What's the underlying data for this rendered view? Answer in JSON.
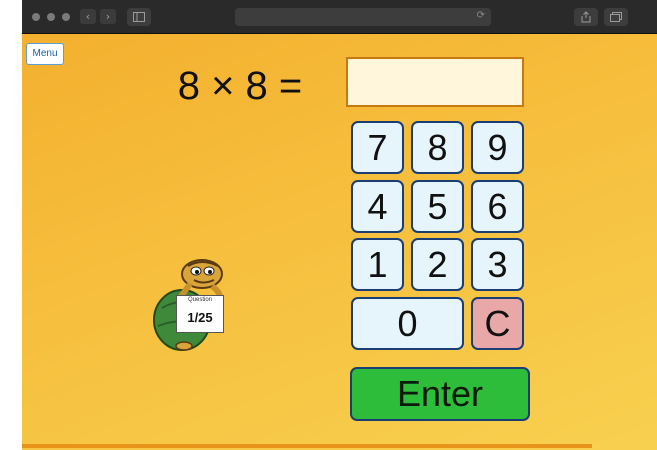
{
  "browser": {
    "nav_back": "‹",
    "nav_forward": "›",
    "sidebar_icon": "sidebar-icon",
    "reload_icon": "⟳",
    "share_icon": "share-icon",
    "tabs_icon": "tabs-icon"
  },
  "game": {
    "menu_label": "Menu",
    "question_text": "8 × 8 =",
    "answer_value": "",
    "keypad": [
      "7",
      "8",
      "9",
      "4",
      "5",
      "6",
      "1",
      "2",
      "3",
      "0",
      "C"
    ],
    "enter_label": "Enter",
    "progress_label": "Question",
    "progress_count": "1/25",
    "colors": {
      "background": "#f6bf3d",
      "key_fill": "#e6f4fb",
      "key_border": "#1a3e73",
      "clear_key": "#e8a8a8",
      "enter_button": "#2dbd3a",
      "answer_border": "#c67a10"
    }
  }
}
